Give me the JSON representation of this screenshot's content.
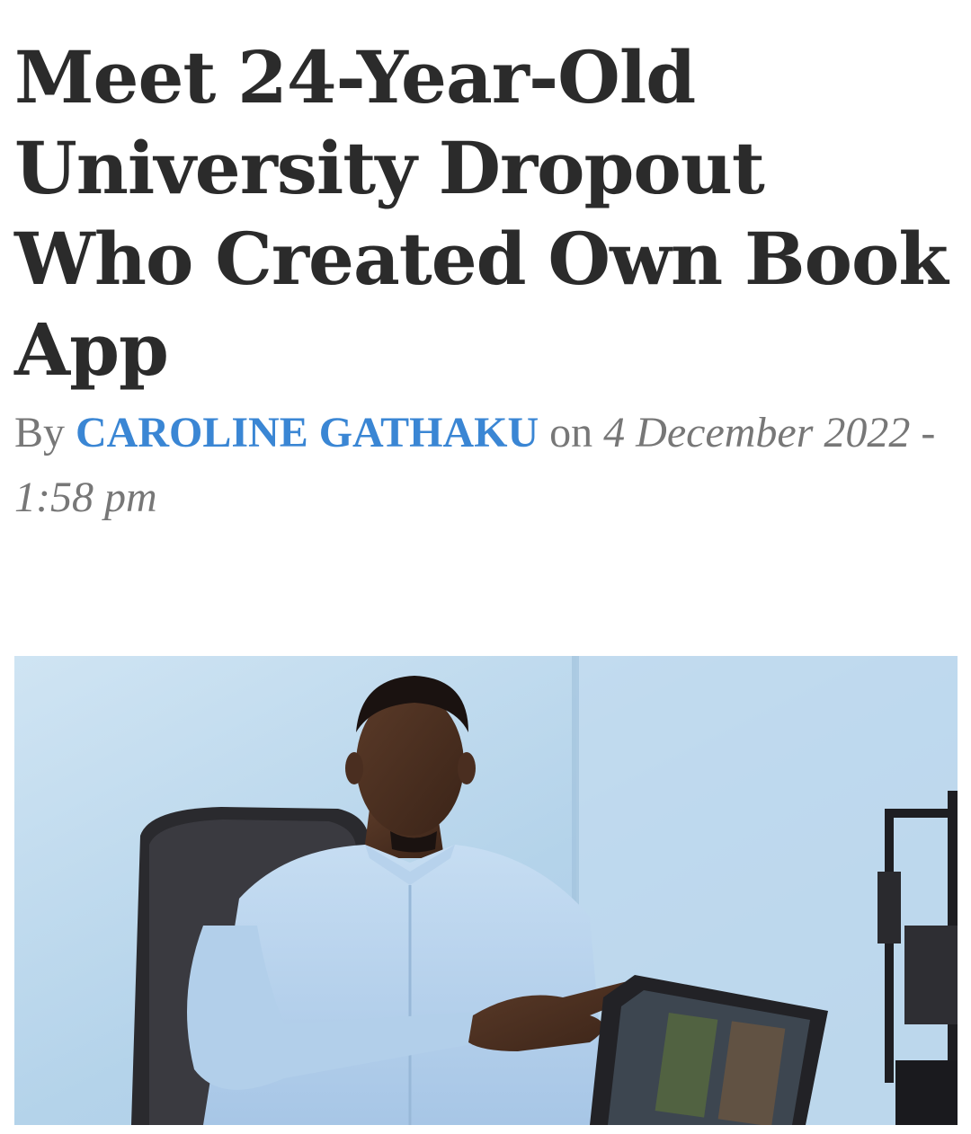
{
  "article": {
    "headline": "Meet 24-Year-Old University Dropout Who Created Own Book App",
    "byline": {
      "by": "By",
      "author": "CAROLINE GATHAKU",
      "on": "on",
      "date": "4 December 2022 - 1:58 pm"
    }
  },
  "colors": {
    "headline": "#2b2b2b",
    "author_link": "#3a86d4",
    "meta_text": "#777777"
  }
}
